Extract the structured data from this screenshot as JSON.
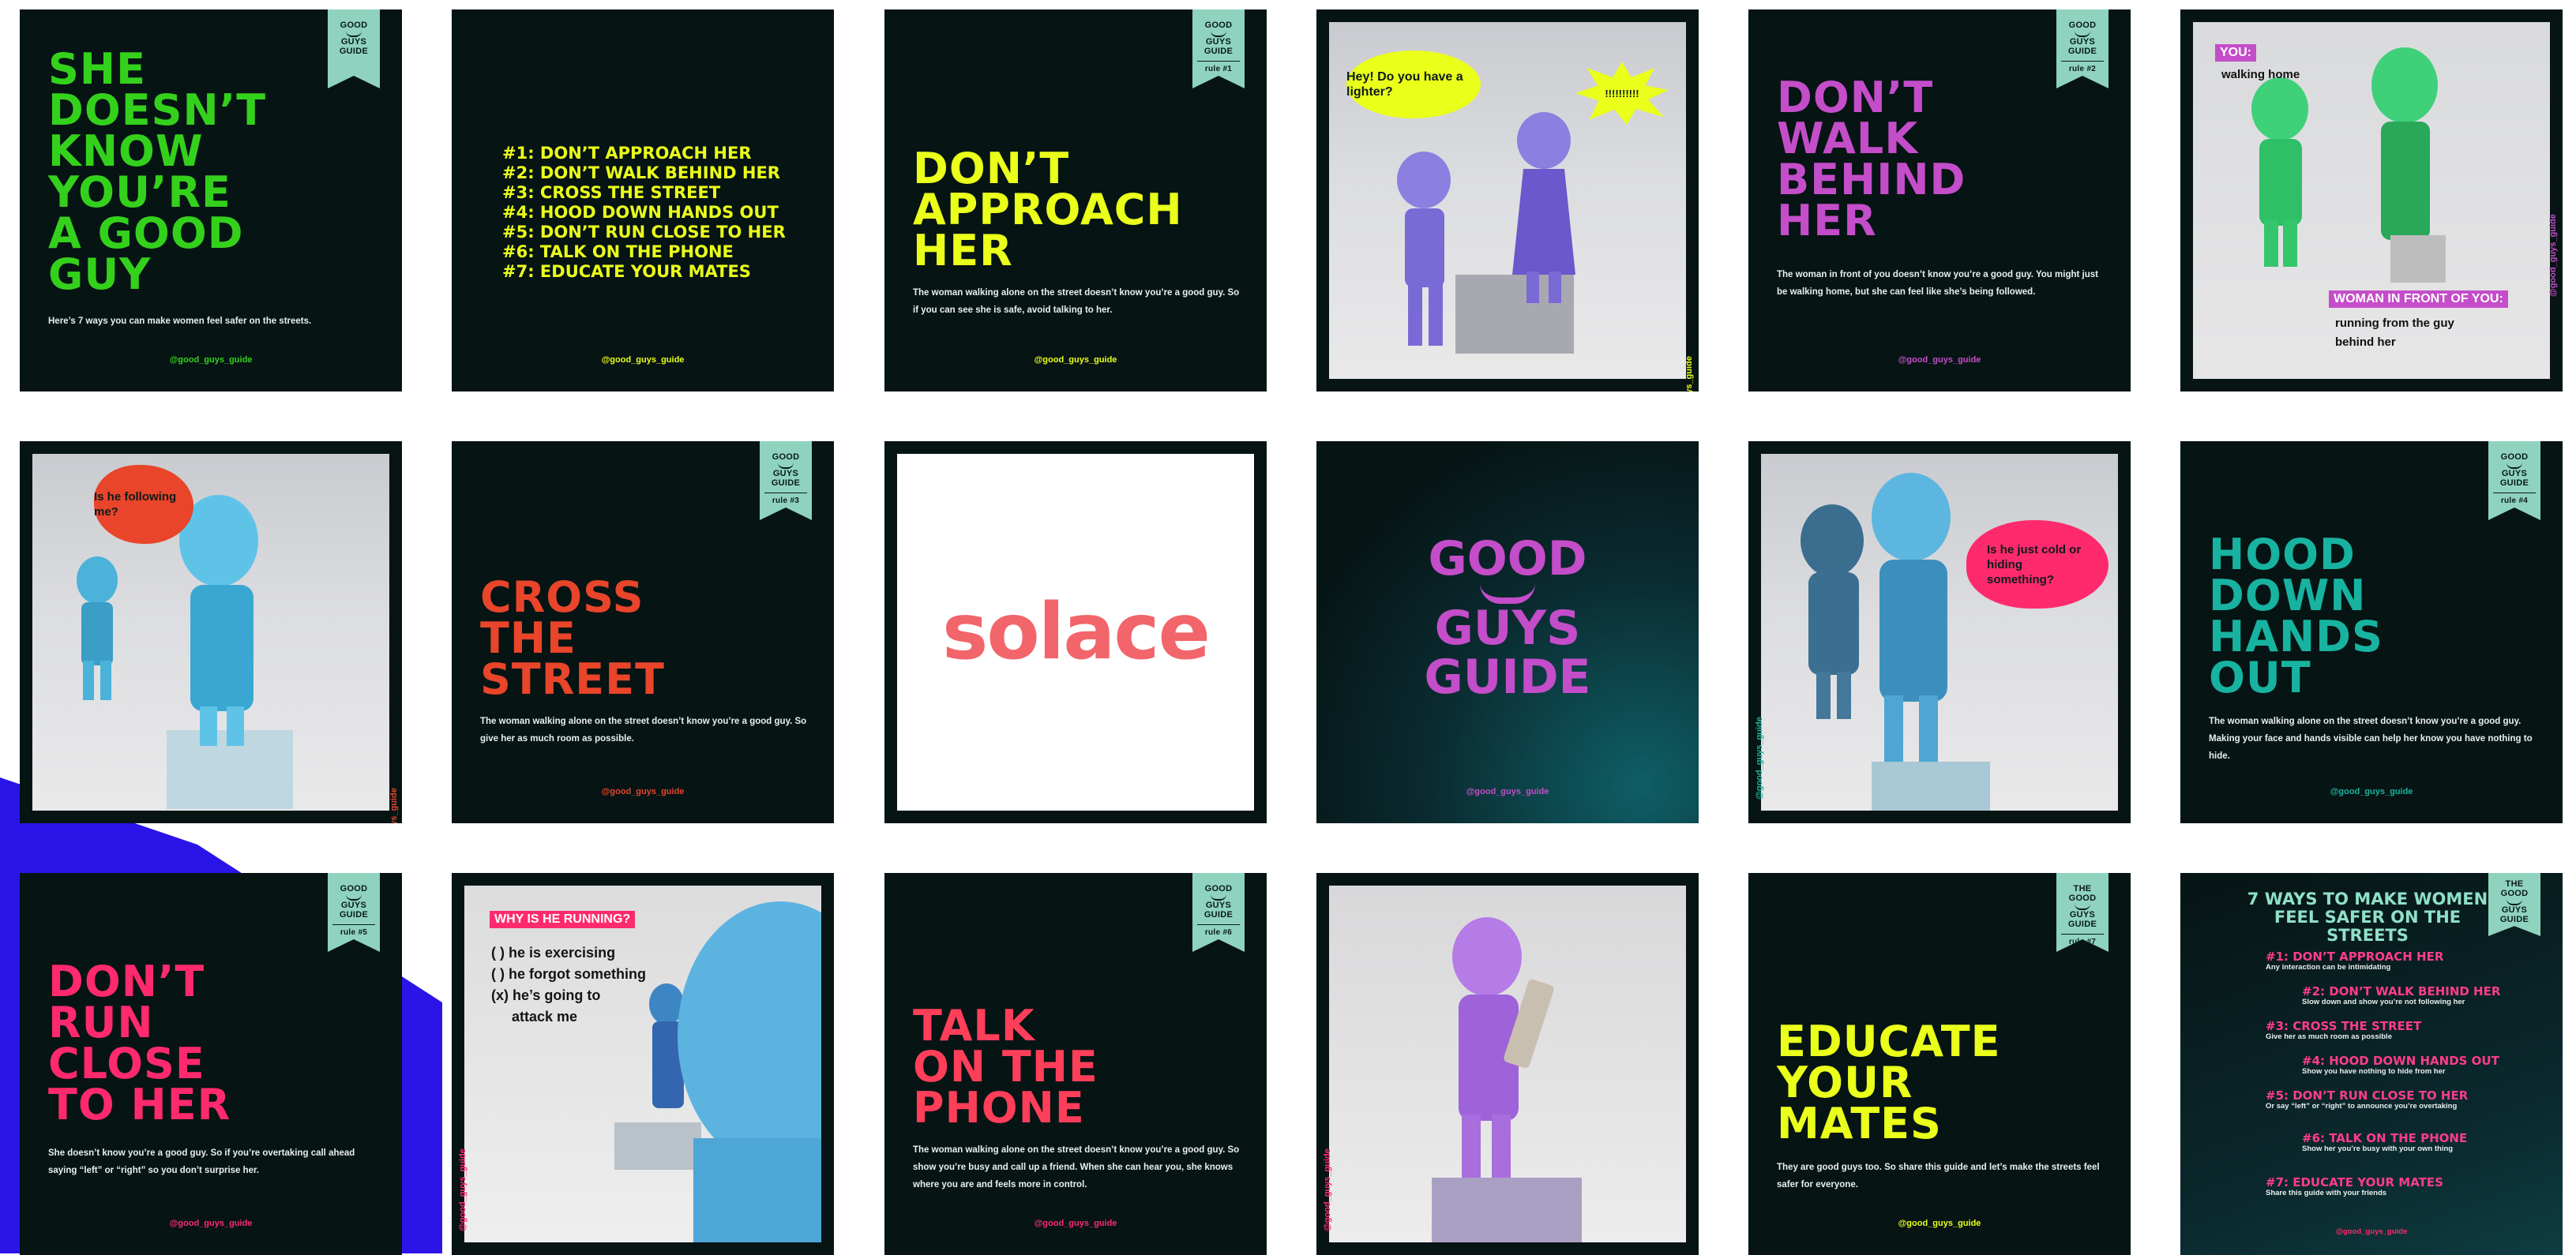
{
  "colors": {
    "tile_bg": "#061414",
    "green": "#34d11c",
    "yellow": "#eaff1a",
    "magenta": "#c44dc9",
    "red_orange": "#e8452a",
    "teal": "#17b3a0",
    "pink": "#ff2a6d",
    "solace_red": "#f2656a",
    "badge_mint": "#8fd3bf",
    "blue_shape": "#2a14e8"
  },
  "badge": {
    "line1": "GOOD",
    "line2": "GUYS",
    "line3": "GUIDE",
    "the": "THE"
  },
  "handle": "@good_guys_guide",
  "tiles": {
    "t1": {
      "title": [
        "SHE",
        "DOESN’T",
        "KNOW",
        "YOU’RE",
        "A GOOD",
        "GUY"
      ],
      "body": "Here’s 7 ways you can make women feel safer on the streets."
    },
    "t2": {
      "rules": [
        "#1: DON’T APPROACH HER",
        "#2: DON’T WALK BEHIND HER",
        "#3: CROSS THE STREET",
        "#4: HOOD DOWN HANDS OUT",
        "#5: DON’T RUN CLOSE TO HER",
        "#6: TALK ON THE PHONE",
        "#7: EDUCATE YOUR MATES"
      ]
    },
    "t3": {
      "rule": "rule #1",
      "title": [
        "DON’T",
        "APPROACH",
        "HER"
      ],
      "body": "The woman walking alone on the street doesn’t know you’re a good guy. So if you can see she is safe, avoid talking to her."
    },
    "t4": {
      "bubble1": "Hey! Do you have a lighter?",
      "bubble2": "!!!!!!!!!!"
    },
    "t5": {
      "rule": "rule #2",
      "title": [
        "DON’T",
        "WALK",
        "BEHIND",
        "HER"
      ],
      "body": "The woman in front of you doesn’t know you’re a good guy. You might just be walking home, but she can feel like she’s being followed."
    },
    "t6": {
      "you_tag": "YOU:",
      "you_text": "walking home",
      "woman_tag": "WOMAN IN FRONT OF YOU:",
      "woman_text": "running from the guy behind her"
    },
    "t7": {
      "bubble": "Is he following me?"
    },
    "t8": {
      "rule": "rule #3",
      "title": [
        "CROSS",
        "THE",
        "STREET"
      ],
      "body": "The woman walking alone on the street doesn’t know you’re a good guy. So give her as much room as possible."
    },
    "t9": {
      "logo": "solace"
    },
    "t10": {
      "logo": [
        "GOOD",
        "GUYS",
        "GUIDE"
      ]
    },
    "t11": {
      "bubble": "Is he just cold or hiding something?"
    },
    "t12": {
      "rule": "rule #4",
      "title": [
        "HOOD",
        "DOWN",
        "HANDS",
        "OUT"
      ],
      "body": "The woman walking alone on the street doesn’t know you’re a good guy. Making your face and hands visible can help her know you have nothing to hide."
    },
    "t13": {
      "rule": "rule #5",
      "title": [
        "DON’T",
        "RUN",
        "CLOSE",
        "TO HER"
      ],
      "body": "She doesn’t know you’re a good guy. So if you’re overtaking call ahead saying “left” or “right” so you don’t surprise her."
    },
    "t14": {
      "tag": "WHY IS HE RUNNING?",
      "options": [
        "( ) he is exercising",
        "( ) he forgot something",
        "(x) he’s going to",
        "attack me"
      ]
    },
    "t15": {
      "rule": "rule #6",
      "title": [
        "TALK",
        "ON THE",
        "PHONE"
      ],
      "body": "The woman walking alone on the street doesn’t know you’re a good guy. So show you’re busy and call up a friend. When she can hear you, she knows where you are and feels more in control."
    },
    "t16": {},
    "t17": {
      "rule": "rule #7",
      "title": [
        "EDUCATE",
        "YOUR",
        "MATES"
      ],
      "body": "They are good guys too. So share this guide and let’s make the streets feel safer for everyone."
    },
    "t18": {
      "title": "7 WAYS TO MAKE WOMEN FEEL SAFER ON THE STREETS",
      "items": [
        {
          "h": "#1: DON’T APPROACH HER",
          "s": "Any interaction can be intimidating"
        },
        {
          "h": "#2: DON’T WALK BEHIND HER",
          "s": "Slow down and show you’re not following her"
        },
        {
          "h": "#3: CROSS THE STREET",
          "s": "Give her as much room as possible"
        },
        {
          "h": "#4: HOOD DOWN HANDS OUT",
          "s": "Show you have nothing to hide from her"
        },
        {
          "h": "#5: DON’T RUN CLOSE TO HER",
          "s": "Or say “left” or “right” to announce you’re overtaking"
        },
        {
          "h": "#6: TALK ON THE PHONE",
          "s": "Show her you’re busy with your own thing"
        },
        {
          "h": "#7: EDUCATE YOUR MATES",
          "s": "Share this guide with your friends"
        }
      ]
    }
  }
}
